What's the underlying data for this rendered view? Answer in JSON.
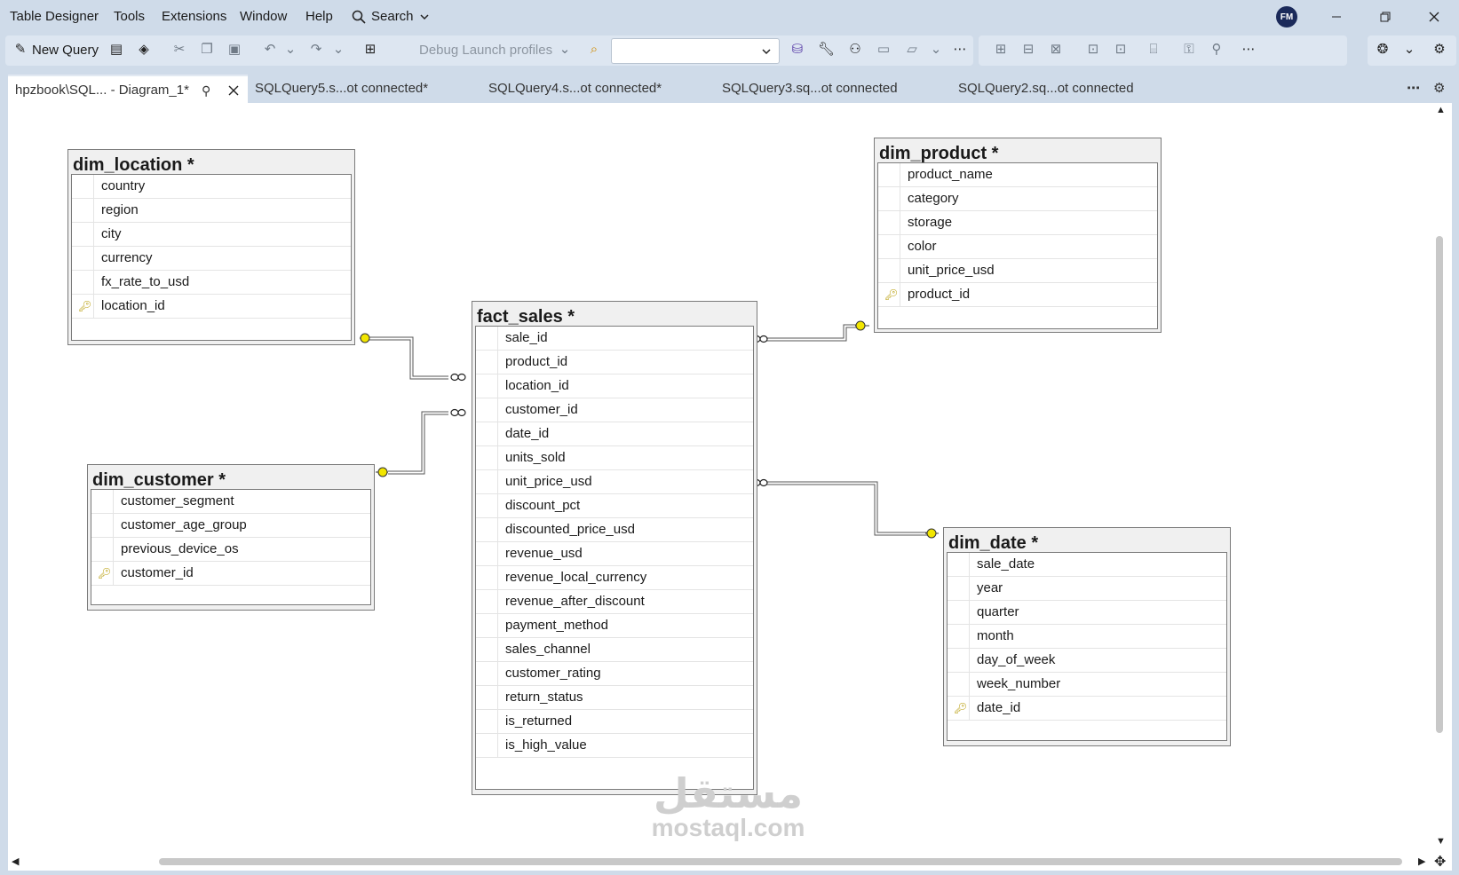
{
  "menubar": {
    "items": [
      "Table Designer",
      "Tools",
      "Extensions",
      "Window",
      "Help"
    ],
    "search_label": "Search",
    "avatar_initials": "FM"
  },
  "toolbar": {
    "new_query_label": "New Query",
    "debug_label": "Debug Launch profiles",
    "combo_value": ""
  },
  "tabs": {
    "active_label": "hpzbook\\SQL... - Diagram_1*",
    "others": [
      "SQLQuery5.s...ot connected*",
      "SQLQuery4.s...ot connected*",
      "SQLQuery3.sq...ot connected",
      "SQLQuery2.sq...ot connected"
    ]
  },
  "tables": {
    "dim_location": {
      "title": "dim_location *",
      "columns": [
        "country",
        "region",
        "city",
        "currency",
        "fx_rate_to_usd",
        "location_id"
      ],
      "key_column": "location_id"
    },
    "dim_product": {
      "title": "dim_product *",
      "columns": [
        "product_name",
        "category",
        "storage",
        "color",
        "unit_price_usd",
        "product_id"
      ],
      "key_column": "product_id"
    },
    "fact_sales": {
      "title": "fact_sales *",
      "columns": [
        "sale_id",
        "product_id",
        "location_id",
        "customer_id",
        "date_id",
        "units_sold",
        "unit_price_usd",
        "discount_pct",
        "discounted_price_usd",
        "revenue_usd",
        "revenue_local_currency",
        "revenue_after_discount",
        "payment_method",
        "sales_channel",
        "customer_rating",
        "return_status",
        "is_returned",
        "is_high_value"
      ],
      "key_column": ""
    },
    "dim_customer": {
      "title": "dim_customer *",
      "columns": [
        "customer_segment",
        "customer_age_group",
        "previous_device_os",
        "customer_id"
      ],
      "key_column": "customer_id"
    },
    "dim_date": {
      "title": "dim_date *",
      "columns": [
        "sale_date",
        "year",
        "quarter",
        "month",
        "day_of_week",
        "week_number",
        "date_id"
      ],
      "key_column": "date_id"
    }
  },
  "watermark": {
    "arabic": "مستقل",
    "latin": "mostaql.com"
  },
  "colors": {
    "key_yellow": "#f2e600",
    "line": "#555555",
    "canvas": "#ffffff",
    "chrome": "#cfdbe9"
  }
}
